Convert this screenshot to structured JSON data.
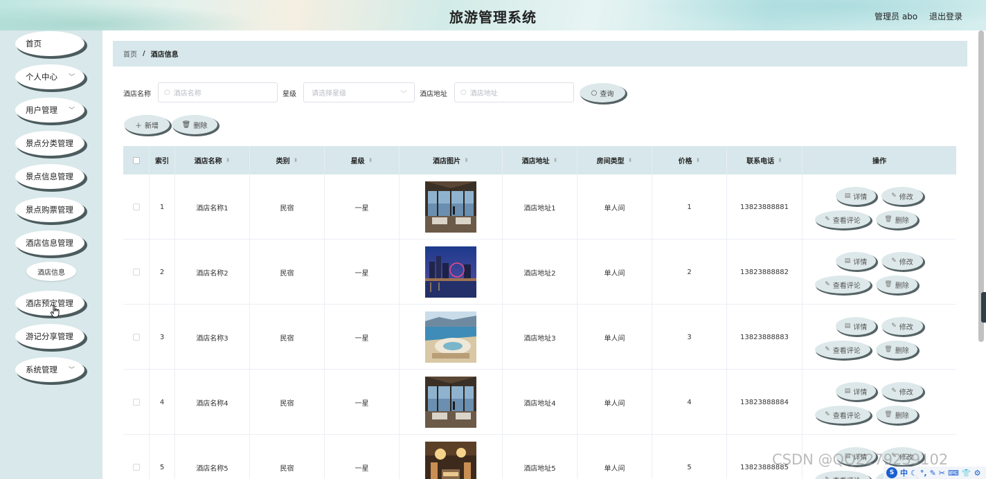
{
  "header": {
    "title": "旅游管理系统",
    "user": "管理员 abo",
    "logout": "退出登录"
  },
  "sidebar": {
    "items": [
      {
        "label": "首页",
        "has_arrow": false
      },
      {
        "label": "个人中心",
        "has_arrow": true
      },
      {
        "label": "用户管理",
        "has_arrow": true
      },
      {
        "label": "景点分类管理",
        "has_arrow": false
      },
      {
        "label": "景点信息管理",
        "has_arrow": false
      },
      {
        "label": "景点购票管理",
        "has_arrow": false
      },
      {
        "label": "酒店信息管理",
        "has_arrow": false
      },
      {
        "label": "酒店预定管理",
        "has_arrow": false
      },
      {
        "label": "游记分享管理",
        "has_arrow": false
      },
      {
        "label": "系统管理",
        "has_arrow": true
      }
    ],
    "submenu": {
      "label": "酒店信息"
    }
  },
  "breadcrumb": {
    "home": "首页",
    "separator": "/",
    "current": "酒店信息"
  },
  "search": {
    "name_label": "酒店名称",
    "name_placeholder": "酒店名称",
    "star_label": "星级",
    "star_placeholder": "请选择星级",
    "address_label": "酒店地址",
    "address_placeholder": "酒店地址",
    "query_button": "查询"
  },
  "toolbar": {
    "add_button": "新增",
    "delete_button": "删除"
  },
  "table": {
    "headers": {
      "index": "索引",
      "name": "酒店名称",
      "type": "类别",
      "star": "星级",
      "image": "酒店图片",
      "address": "酒店地址",
      "room_type": "房间类型",
      "price": "价格",
      "phone": "联系电话",
      "actions": "操作"
    },
    "action_labels": {
      "detail": "详情",
      "edit": "修改",
      "comments": "查看评论",
      "delete": "删除"
    },
    "rows": [
      {
        "index": "1",
        "name": "酒店名称1",
        "type": "民宿",
        "star": "一星",
        "address": "酒店地址1",
        "room_type": "单人间",
        "price": "1",
        "phone": "13823888881",
        "image": "lobby-sea-view"
      },
      {
        "index": "2",
        "name": "酒店名称2",
        "type": "民宿",
        "star": "一星",
        "address": "酒店地址2",
        "room_type": "单人间",
        "price": "2",
        "phone": "13823888882",
        "image": "city-night-ferris-wheel"
      },
      {
        "index": "3",
        "name": "酒店名称3",
        "type": "民宿",
        "star": "一星",
        "address": "酒店地址3",
        "room_type": "单人间",
        "price": "3",
        "phone": "13823888883",
        "image": "coastal-resort-aerial"
      },
      {
        "index": "4",
        "name": "酒店名称4",
        "type": "民宿",
        "star": "一星",
        "address": "酒店地址4",
        "room_type": "单人间",
        "price": "4",
        "phone": "13823888884",
        "image": "lobby-sea-view"
      },
      {
        "index": "5",
        "name": "酒店名称5",
        "type": "民宿",
        "star": "一星",
        "address": "酒店地址5",
        "room_type": "单人间",
        "price": "5",
        "phone": "13823888885",
        "image": "hotel-lobby-chandelier"
      }
    ]
  },
  "watermark": "CSDN @QQ2279239102",
  "ime": "中"
}
